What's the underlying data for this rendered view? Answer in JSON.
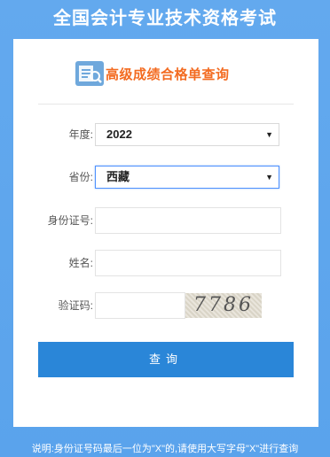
{
  "page": {
    "title": "全国会计专业技术资格考试"
  },
  "section": {
    "title": "高级成绩合格单查询",
    "icon": "search-document-icon"
  },
  "form": {
    "year": {
      "label": "年度:",
      "value": "2022"
    },
    "province": {
      "label": "省份:",
      "value": "西藏"
    },
    "id_number": {
      "label": "身份证号:",
      "value": ""
    },
    "name": {
      "label": "姓名:",
      "value": ""
    },
    "captcha": {
      "label": "验证码:",
      "value": "",
      "image_text": "7786"
    },
    "submit_label": "查询"
  },
  "note": "说明:身份证号码最后一位为\"X\"的,请使用大写字母\"X\"进行查询"
}
